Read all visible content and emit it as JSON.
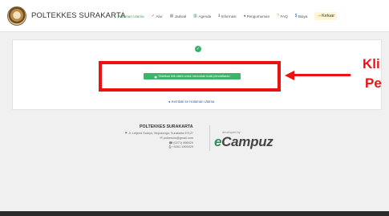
{
  "header": {
    "brand": "POLTEKKES SURAKARTA",
    "menu": [
      {
        "label": "Halaman Utama",
        "icon": "home-icon",
        "glyph": "⌂"
      },
      {
        "label": "Alur",
        "icon": "check-icon",
        "glyph": "✓"
      },
      {
        "label": "Jadwal",
        "icon": "calendar-icon",
        "glyph": "▦"
      },
      {
        "label": "Agenda",
        "icon": "agenda-icon",
        "glyph": "▥"
      },
      {
        "label": "Informasi",
        "icon": "info-icon",
        "glyph": "ℹ"
      },
      {
        "label": "Pengumuman",
        "icon": "megaphone-icon",
        "glyph": "◂"
      },
      {
        "label": "FAQ",
        "icon": "question-icon",
        "glyph": "?"
      },
      {
        "label": "Biaya",
        "icon": "money-icon",
        "glyph": "$"
      },
      {
        "label": "Keluar",
        "icon": "logout-icon",
        "glyph": "⇥"
      }
    ]
  },
  "main": {
    "print_button_label": "Silahkan klik disini untuk mencetak bukti pendaftaran",
    "back_link": "Kembali ke Halaman Utama"
  },
  "annotation": {
    "line1": "Kli",
    "line2": "Pe"
  },
  "footer": {
    "institution": "POLTEKKES SURAKARTA",
    "address": "Jl. Letjend Sutoyo, Mojosongo, Surakarta 57127",
    "email": "polkesolo@gmail.com",
    "phone": "(0271) 856929",
    "fax": "+0281 1909929",
    "developed_by": "developed by",
    "brand_part1": "e",
    "brand_part2": "Campuz"
  },
  "colors": {
    "highlight": "#ee1111",
    "button_green": "#3cb56b",
    "link_blue": "#3c64b0"
  }
}
